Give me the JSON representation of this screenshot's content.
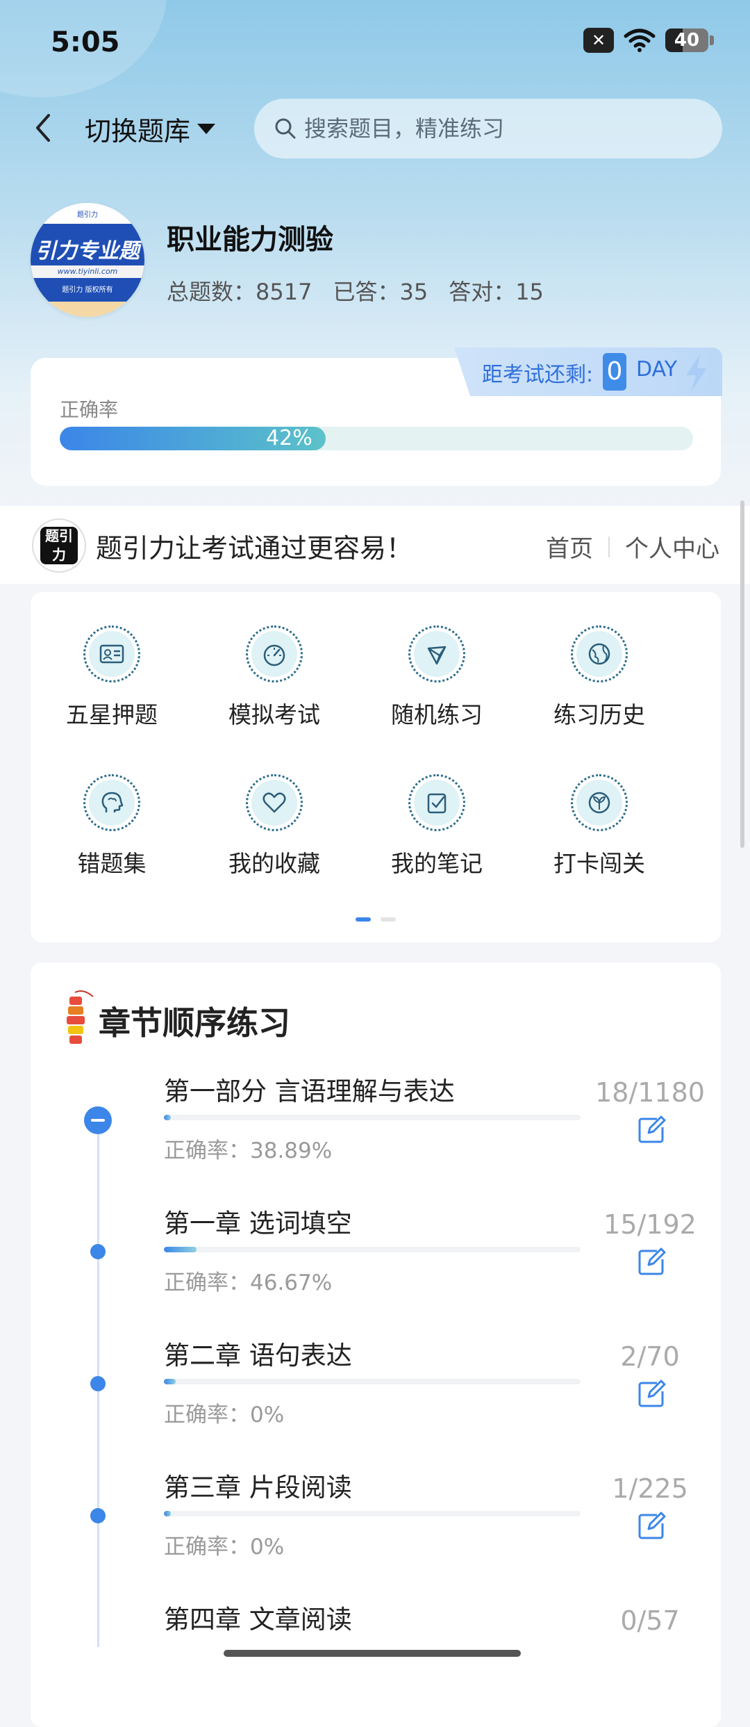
{
  "status_bar": {
    "time": "5:05",
    "battery": "40",
    "battery_level": 0.4
  },
  "header": {
    "switch_label": "切换题库",
    "search_placeholder": "搜索题目，精准练习"
  },
  "bank": {
    "title": "职业能力测验",
    "total_label": "总题数：8517",
    "answered_label": "已答：35",
    "correct_label": "答对：15",
    "logo_text": "引力专业题",
    "logo_url": "www.tiyinli.com",
    "logo_copy": "题引力 版权所有"
  },
  "exam": {
    "countdown_label": "距考试还剩:",
    "days": "0",
    "unit": "DAY"
  },
  "accuracy": {
    "label": "正确率",
    "value_text": "42%",
    "value": 0.42
  },
  "banner": {
    "slogan": "题引力让考试通过更容易！",
    "nav_home": "首页",
    "nav_profile": "个人中心",
    "logo_text": "题引力"
  },
  "grid": {
    "items": [
      {
        "label": "五星押题",
        "icon": "id-card-icon"
      },
      {
        "label": "模拟考试",
        "icon": "gauge-icon"
      },
      {
        "label": "随机练习",
        "icon": "network-icon"
      },
      {
        "label": "练习历史",
        "icon": "globe-icon"
      },
      {
        "label": "错题集",
        "icon": "brain-head-icon"
      },
      {
        "label": "我的收藏",
        "icon": "heart-icon"
      },
      {
        "label": "我的笔记",
        "icon": "note-check-icon"
      },
      {
        "label": "打卡闯关",
        "icon": "sprout-icon"
      }
    ],
    "page": 1,
    "pages": 2
  },
  "chapters": {
    "title": "章节顺序练习",
    "items": [
      {
        "name": "第一部分 言语理解与表达",
        "accuracy": "正确率：38.89%",
        "count": "18/1180",
        "progress": 0.0153
      },
      {
        "name": "第一章 选词填空",
        "accuracy": "正确率：46.67%",
        "count": "15/192",
        "progress": 0.078
      },
      {
        "name": "第二章 语句表达",
        "accuracy": "正确率：0%",
        "count": "2/70",
        "progress": 0.029
      },
      {
        "name": "第三章 片段阅读",
        "accuracy": "正确率：0%",
        "count": "1/225",
        "progress": 0.0044
      },
      {
        "name": "第四章 文章阅读",
        "accuracy": "",
        "count": "0/57",
        "progress": 0
      }
    ]
  },
  "colors": {
    "accent": "#3b86e8",
    "teal": "#5cc2c9"
  }
}
